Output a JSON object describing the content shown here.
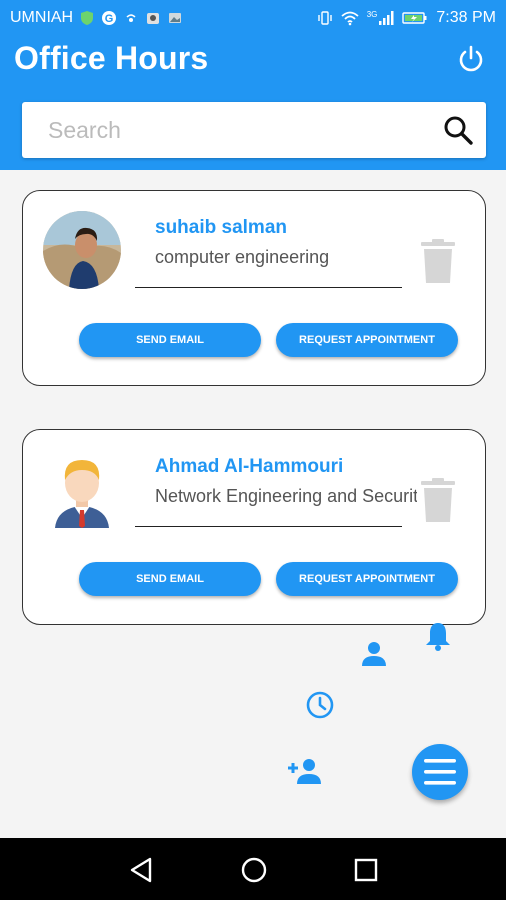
{
  "status_bar": {
    "carrier": "UMNIAH",
    "network": "3G",
    "time": "7:38 PM"
  },
  "app": {
    "title": "Office Hours"
  },
  "search": {
    "placeholder": "Search"
  },
  "professors": [
    {
      "name": "suhaib salman",
      "department": "computer engineering",
      "send_email_label": "SEND EMAIL",
      "request_label": "REQUEST APPOINTMENT"
    },
    {
      "name": "Ahmad Al-Hammouri",
      "department": "Network Engineering and Security",
      "send_email_label": "SEND EMAIL",
      "request_label": "REQUEST APPOINTMENT"
    }
  ],
  "colors": {
    "primary": "#2196f3",
    "background": "#f4f4f4",
    "trash": "#d6d6d6"
  },
  "icons": [
    "power-icon",
    "search-icon",
    "trash-icon",
    "bell-icon",
    "person-icon",
    "clock-icon",
    "person-add-icon",
    "menu-icon",
    "back-icon",
    "home-icon",
    "recents-icon"
  ]
}
